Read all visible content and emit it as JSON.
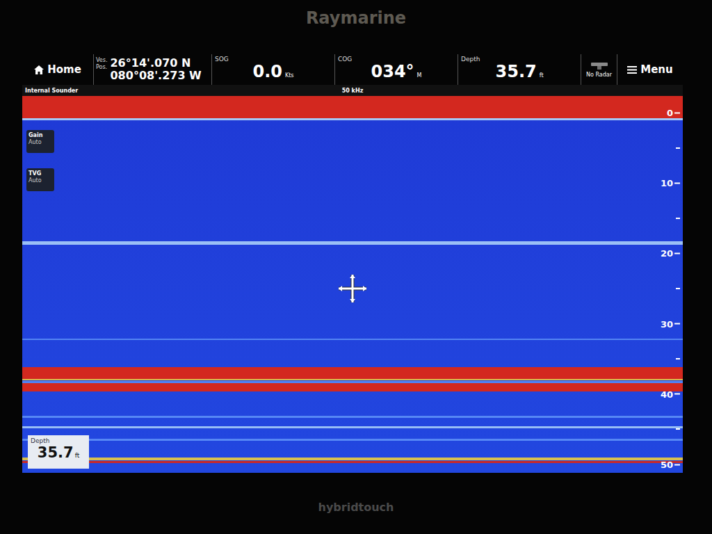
{
  "brand": "Raymarine",
  "model": "hybridtouch",
  "top_bar": {
    "home": "Home",
    "position": {
      "label": [
        "Ves.",
        "Pos."
      ],
      "lat": "26°14'.070 N",
      "lon": "080°08'.273 W"
    },
    "readouts": [
      {
        "label": "SOG",
        "value": "0.0",
        "unit": "Kts"
      },
      {
        "label": "COG",
        "value": "034°",
        "unit": "M"
      },
      {
        "label": "Depth",
        "value": "35.7",
        "unit": "ft"
      }
    ],
    "radar": "No Radar",
    "menu": "Menu"
  },
  "sounder": {
    "title": "Internal Sounder",
    "frequency": "50 kHz",
    "controls": [
      {
        "label": "Gain",
        "value": "Auto"
      },
      {
        "label": "TVG",
        "value": "Auto"
      }
    ],
    "scale": [
      "0",
      "10",
      "20",
      "30",
      "40",
      "50"
    ],
    "echoes": [
      {
        "depth": -2.4,
        "thickness": 3.2,
        "level": 1
      },
      {
        "depth": 0.8,
        "thickness": 0.3,
        "level": 0.6
      },
      {
        "depth": 18.3,
        "thickness": 0.5,
        "level": 0.5
      },
      {
        "depth": 32.1,
        "thickness": 0.2,
        "level": 0.3
      },
      {
        "depth": 36.2,
        "thickness": 1.6,
        "level": 1
      },
      {
        "depth": 37.8,
        "thickness": 0.25,
        "level": 0.75
      },
      {
        "depth": 38.1,
        "thickness": 0.3,
        "level": 0.3
      },
      {
        "depth": 38.4,
        "thickness": 1.2,
        "level": 1
      },
      {
        "depth": 43.1,
        "thickness": 0.3,
        "level": 0.35
      },
      {
        "depth": 44.6,
        "thickness": 0.3,
        "level": 0.45
      },
      {
        "depth": 46.3,
        "thickness": 0.3,
        "level": 0.35
      },
      {
        "depth": 49.0,
        "thickness": 0.4,
        "level": 0.75
      },
      {
        "depth": 49.5,
        "thickness": 0.3,
        "level": 0.9
      }
    ],
    "depth_box": {
      "label": "Depth",
      "value": "35.7",
      "unit": "ft"
    }
  }
}
